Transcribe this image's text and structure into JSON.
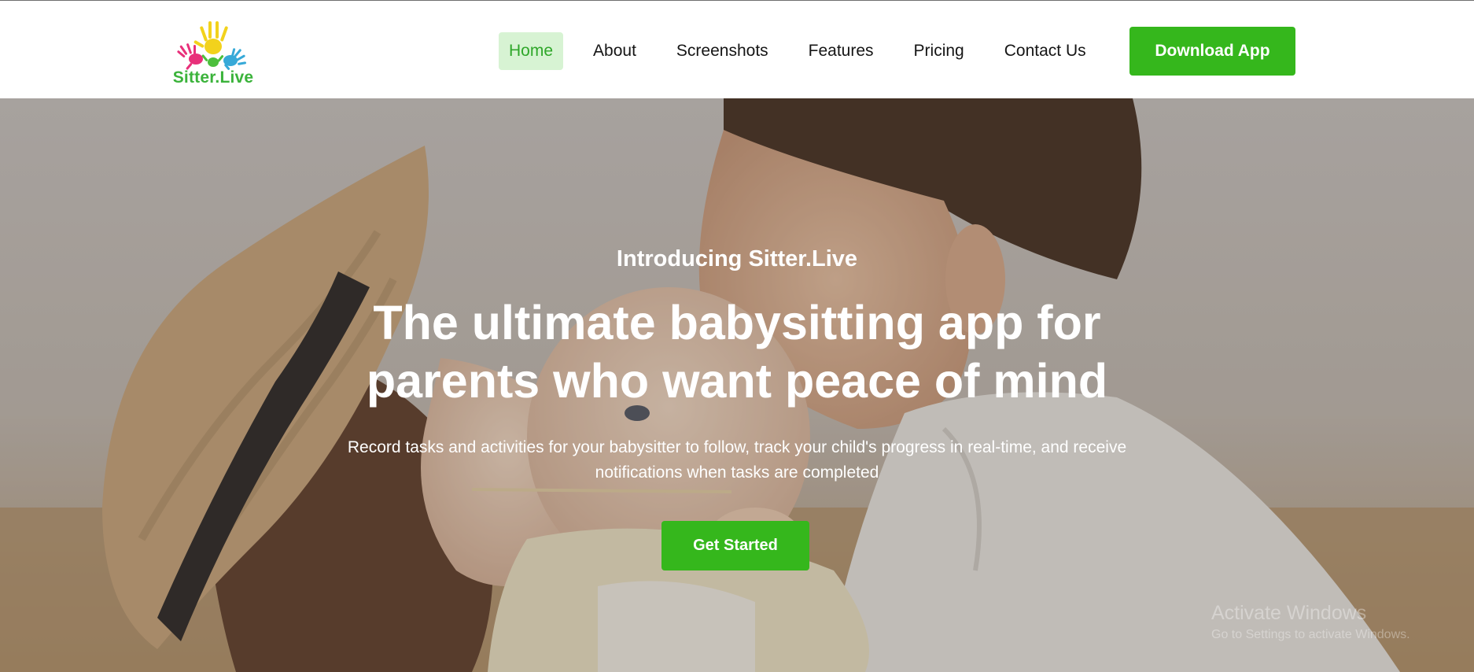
{
  "brand": {
    "name": "Sitter.Live",
    "color": "#3bb33b"
  },
  "nav": {
    "items": [
      {
        "label": "Home",
        "active": true
      },
      {
        "label": "About",
        "active": false
      },
      {
        "label": "Screenshots",
        "active": false
      },
      {
        "label": "Features",
        "active": false
      },
      {
        "label": "Pricing",
        "active": false
      },
      {
        "label": "Contact Us",
        "active": false
      }
    ],
    "download_label": "Download App"
  },
  "hero": {
    "eyebrow": "Introducing Sitter.Live",
    "headline": "The ultimate babysitting app for parents who want peace of mind",
    "subtext": "Record tasks and activities for your babysitter to follow, track your child's progress in real-time, and receive notifications when tasks are completed",
    "cta_label": "Get Started",
    "background_image": "family-kissing-baby-photo"
  },
  "watermark": {
    "title": "Activate Windows",
    "subtitle": "Go to Settings to activate Windows."
  },
  "colors": {
    "accent": "#35b71c",
    "nav_active_bg": "#d7f3d3",
    "nav_active_text": "#2fa72a",
    "text": "#151515"
  }
}
